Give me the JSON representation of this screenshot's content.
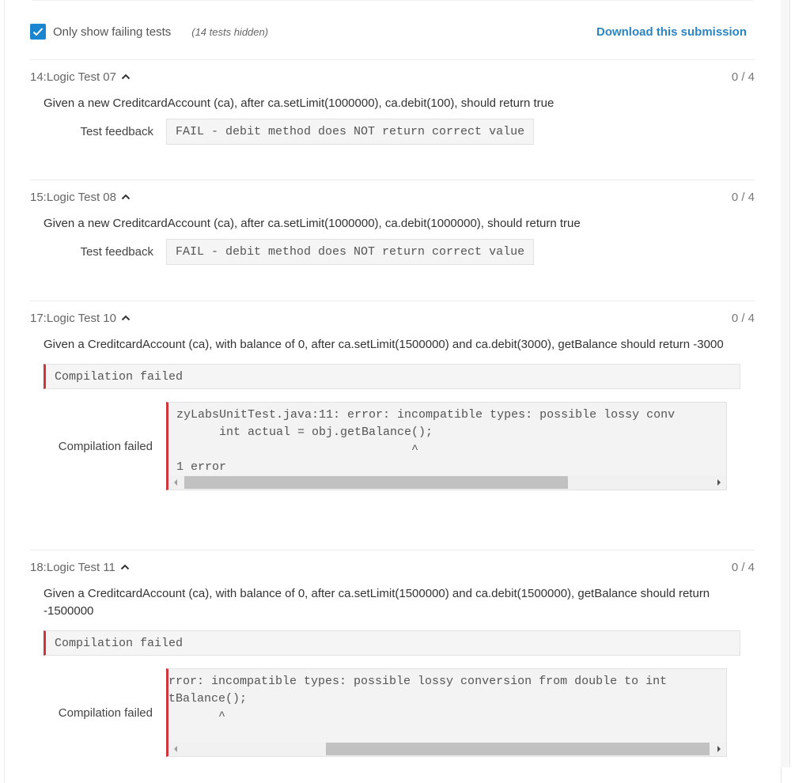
{
  "filter": {
    "checkbox_checked": true,
    "label": "Only show failing tests",
    "hidden_count": "(14 tests hidden)",
    "download_label": "Download this submission",
    "accent_color": "#1a86d0",
    "link_color": "#2c84c0"
  },
  "tests": [
    {
      "title": "14:Logic Test 07",
      "score": "0 / 4",
      "description": "Given a new CreditcardAccount (ca), after ca.setLimit(1000000), ca.debit(100), should return true",
      "feedback_label": "Test feedback",
      "feedback": "FAIL - debit method does NOT return correct value"
    },
    {
      "title": "15:Logic Test 08",
      "score": "0 / 4",
      "description": "Given a new CreditcardAccount (ca), after ca.setLimit(1000000), ca.debit(1000000), should return true",
      "feedback_label": "Test feedback",
      "feedback": "FAIL - debit method does NOT return correct value"
    },
    {
      "title": "17:Logic Test 10",
      "score": "0 / 4",
      "description": "Given a CreditcardAccount (ca), with balance of 0, after ca.setLimit(1500000) and ca.debit(3000), getBalance should return -3000",
      "compilation_status": "Compilation failed",
      "error_label": "Compilation failed",
      "error_output": "zyLabsUnitTest.java:11: error: incompatible types: possible lossy conv\n      int actual = obj.getBalance();\n                                 ^\n1 error",
      "scroll_position": 0
    },
    {
      "title": "18:Logic Test 11",
      "score": "0 / 4",
      "description": "Given a CreditcardAccount (ca), with balance of 0, after ca.setLimit(1500000) and ca.debit(1500000), getBalance should return -1500000",
      "compilation_status": "Compilation failed",
      "error_label": "Compilation failed",
      "error_output": "rror: incompatible types: possible lossy conversion from double to int\ntBalance();\n       ^\n",
      "scroll_position": 1
    }
  ],
  "status_colors": {
    "error_bar": "#d0353b"
  }
}
